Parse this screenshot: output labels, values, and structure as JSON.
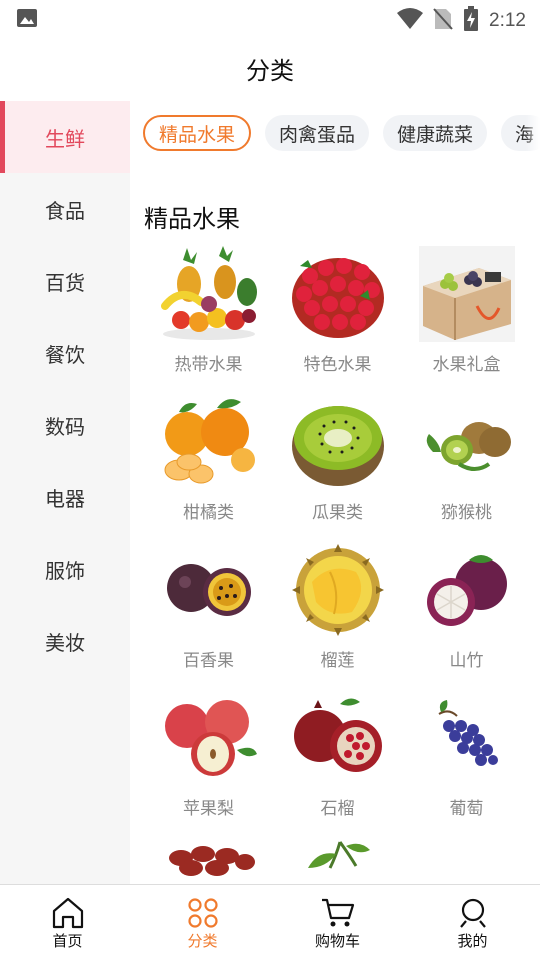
{
  "status_bar": {
    "time": "2:12"
  },
  "header": {
    "title": "分类"
  },
  "sidebar": {
    "items": [
      {
        "label": "生鲜"
      },
      {
        "label": "食品"
      },
      {
        "label": "百货"
      },
      {
        "label": "餐饮"
      },
      {
        "label": "数码"
      },
      {
        "label": "电器"
      },
      {
        "label": "服饰"
      },
      {
        "label": "美妆"
      }
    ],
    "active_index": 0
  },
  "tabs": [
    {
      "label": "精品水果"
    },
    {
      "label": "肉禽蛋品"
    },
    {
      "label": "健康蔬菜"
    },
    {
      "label": "海"
    }
  ],
  "section": {
    "title": "精品水果"
  },
  "products": [
    {
      "label": "热带水果",
      "icon": "tropical-fruits-image"
    },
    {
      "label": "特色水果",
      "icon": "raspberry-basket-image"
    },
    {
      "label": "水果礼盒",
      "icon": "fruit-giftbox-image"
    },
    {
      "label": "柑橘类",
      "icon": "citrus-image"
    },
    {
      "label": "瓜果类",
      "icon": "kiwi-slice-image"
    },
    {
      "label": "猕猴桃",
      "icon": "kiwi-image"
    },
    {
      "label": "百香果",
      "icon": "passion-fruit-image"
    },
    {
      "label": "榴莲",
      "icon": "durian-image"
    },
    {
      "label": "山竹",
      "icon": "mangosteen-image"
    },
    {
      "label": "苹果梨",
      "icon": "apple-image"
    },
    {
      "label": "石榴",
      "icon": "pomegranate-image"
    },
    {
      "label": "葡萄",
      "icon": "grape-image"
    },
    {
      "label": "",
      "icon": "dates-image"
    },
    {
      "label": "",
      "icon": "cherry-image"
    }
  ],
  "bottom_nav": [
    {
      "label": "首页",
      "icon": "home-icon"
    },
    {
      "label": "分类",
      "icon": "category-icon"
    },
    {
      "label": "购物车",
      "icon": "cart-icon"
    },
    {
      "label": "我的",
      "icon": "user-icon"
    }
  ],
  "colors": {
    "accent": "#f07a2d",
    "sidebar_active": "#e2485c"
  }
}
